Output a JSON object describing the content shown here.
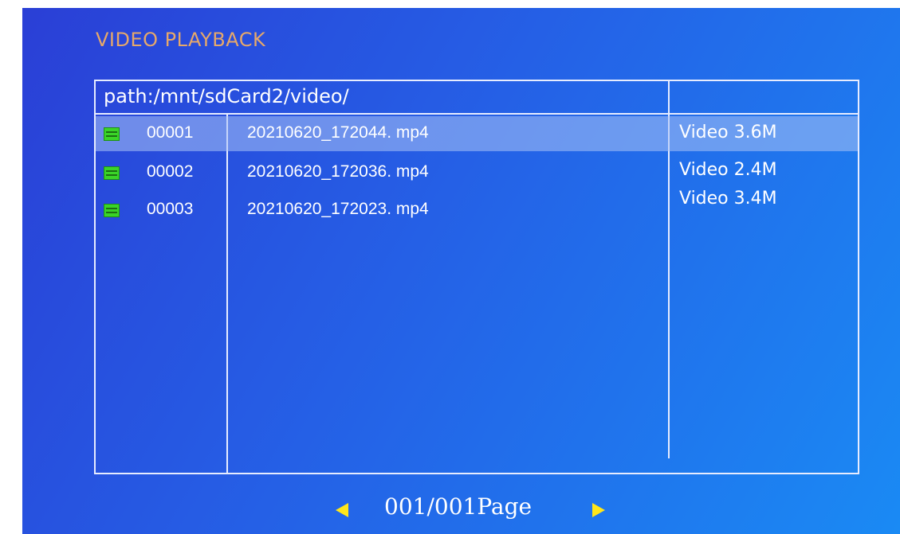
{
  "header": {
    "title": "VIDEO PLAYBACK"
  },
  "browser": {
    "path": "path:/mnt/sdCard2/video/",
    "selected_index": 0,
    "files": [
      {
        "number": "00001",
        "name": "20210620_172044. mp4",
        "size": "Video 3.6M",
        "icon": "video-file-icon"
      },
      {
        "number": "00002",
        "name": "20210620_172036. mp4",
        "size": "Video 2.4M",
        "icon": "video-file-icon"
      },
      {
        "number": "00003",
        "name": "20210620_172023. mp4",
        "size": "Video 3.4M",
        "icon": "video-file-icon"
      }
    ]
  },
  "pager": {
    "label": "001/001Page"
  },
  "colors": {
    "title": "#e6a86a",
    "arrow": "#ffe61a",
    "icon": "#3ad428",
    "border": "#e6ecff"
  }
}
